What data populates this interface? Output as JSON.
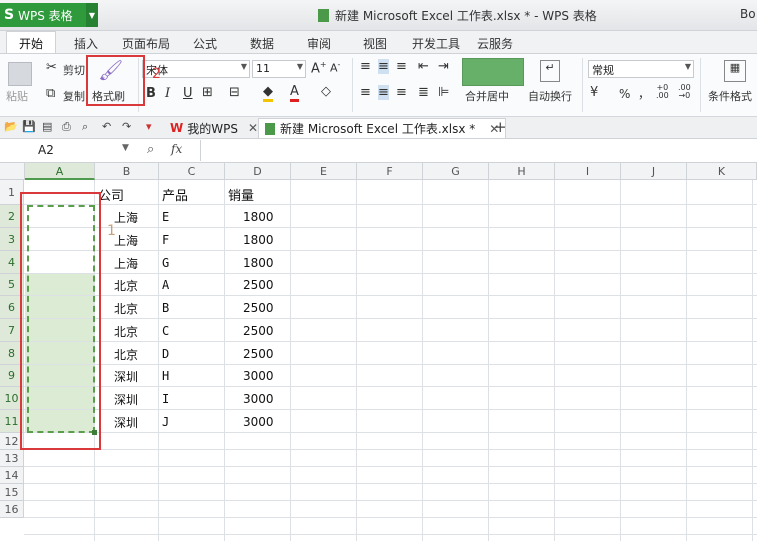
{
  "app": {
    "badge": "WPS 表格",
    "title": "新建 Microsoft Excel 工作表.xlsx * - WPS 表格",
    "corner_text": "Bo"
  },
  "menu": {
    "tabs": [
      "开始",
      "插入",
      "页面布局",
      "公式",
      "数据",
      "审阅",
      "视图",
      "开发工具",
      "云服务"
    ],
    "active": "开始"
  },
  "ribbon": {
    "paste": "粘贴",
    "cut": "剪切",
    "copy": "复制",
    "format_painter": "格式刷",
    "font_name": "宋体",
    "font_size": "11",
    "bold": "B",
    "italic": "I",
    "underline": "U",
    "merge_center": "合并居中",
    "wrap_text": "自动换行",
    "number_format": "常规",
    "percent": "%",
    "comma": "，",
    "conditional_format": "条件格式"
  },
  "quickbar": {
    "home_tab": "我的WPS",
    "doc_tab": "新建 Microsoft Excel 工作表.xlsx *"
  },
  "formula": {
    "cell_ref": "A2",
    "fx": "fx",
    "value": ""
  },
  "grid": {
    "columns": [
      "A",
      "B",
      "C",
      "D",
      "E",
      "F",
      "G",
      "H",
      "I",
      "J",
      "K"
    ],
    "rows": [
      "1",
      "2",
      "3",
      "4",
      "5",
      "6",
      "7",
      "8",
      "9",
      "10",
      "11",
      "12",
      "13",
      "14",
      "15",
      "16"
    ],
    "header": {
      "company": "公司",
      "product": "产品",
      "sales": "销量"
    },
    "data": [
      [
        "上海",
        "E",
        "1800"
      ],
      [
        "上海",
        "F",
        "1800"
      ],
      [
        "上海",
        "G",
        "1800"
      ],
      [
        "北京",
        "A",
        "2500"
      ],
      [
        "北京",
        "B",
        "2500"
      ],
      [
        "北京",
        "C",
        "2500"
      ],
      [
        "北京",
        "D",
        "2500"
      ],
      [
        "深圳",
        "H",
        "3000"
      ],
      [
        "深圳",
        "I",
        "3000"
      ],
      [
        "深圳",
        "J",
        "3000"
      ]
    ]
  },
  "annotations": {
    "label_1": "1",
    "label_2": "2"
  },
  "colors": {
    "accent": "#2e9a3c",
    "highlight_box": "#d9393b",
    "selection": "#dcebd3"
  }
}
